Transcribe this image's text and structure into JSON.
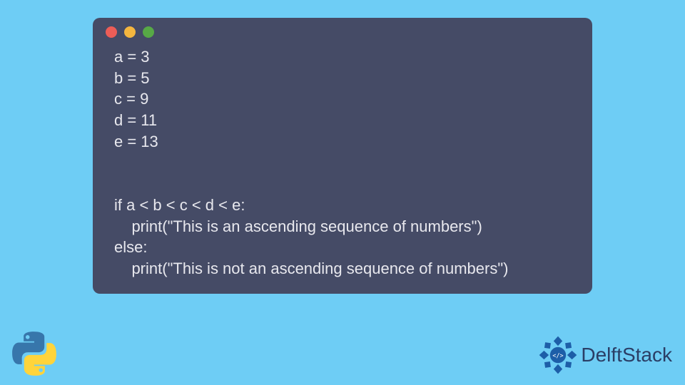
{
  "code": {
    "lines": [
      "a = 3",
      "b = 5",
      "c = 9",
      "d = 11",
      "e = 13",
      "",
      "",
      "if a < b < c < d < e:",
      "    print(\"This is an ascending sequence of numbers\")",
      "else:",
      "    print(\"This is not an ascending sequence of numbers\")"
    ]
  },
  "brand": {
    "name": "DelftStack"
  },
  "colors": {
    "bg": "#6ecdf5",
    "window": "#454b66",
    "dot_red": "#ec5d57",
    "dot_yellow": "#f4b63f",
    "dot_green": "#57a946"
  }
}
